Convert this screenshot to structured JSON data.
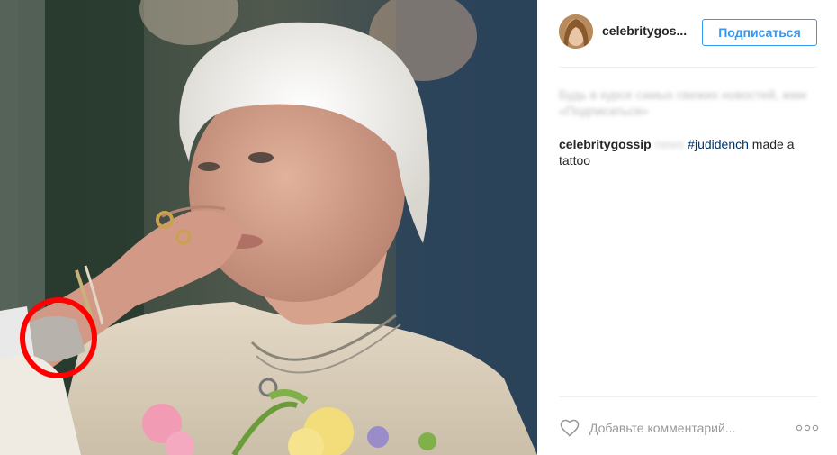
{
  "post": {
    "username": "celebritygos...",
    "follow_label": "Подписаться",
    "blurred_text": "Будь в курсе самых свежих новостей, жми «Подписаться»",
    "caption": {
      "username": "celebritygossip",
      "hidden": "news",
      "hashtag": "#judidench",
      "text": "made a tattoo"
    }
  },
  "footer": {
    "comment_placeholder": "Добавьте комментарий...",
    "like_icon": "heart-outline-icon",
    "more_icon": "more-options-icon"
  },
  "colors": {
    "accent": "#3897f0",
    "hashtag": "#003569",
    "highlight_circle": "#ff0000"
  }
}
